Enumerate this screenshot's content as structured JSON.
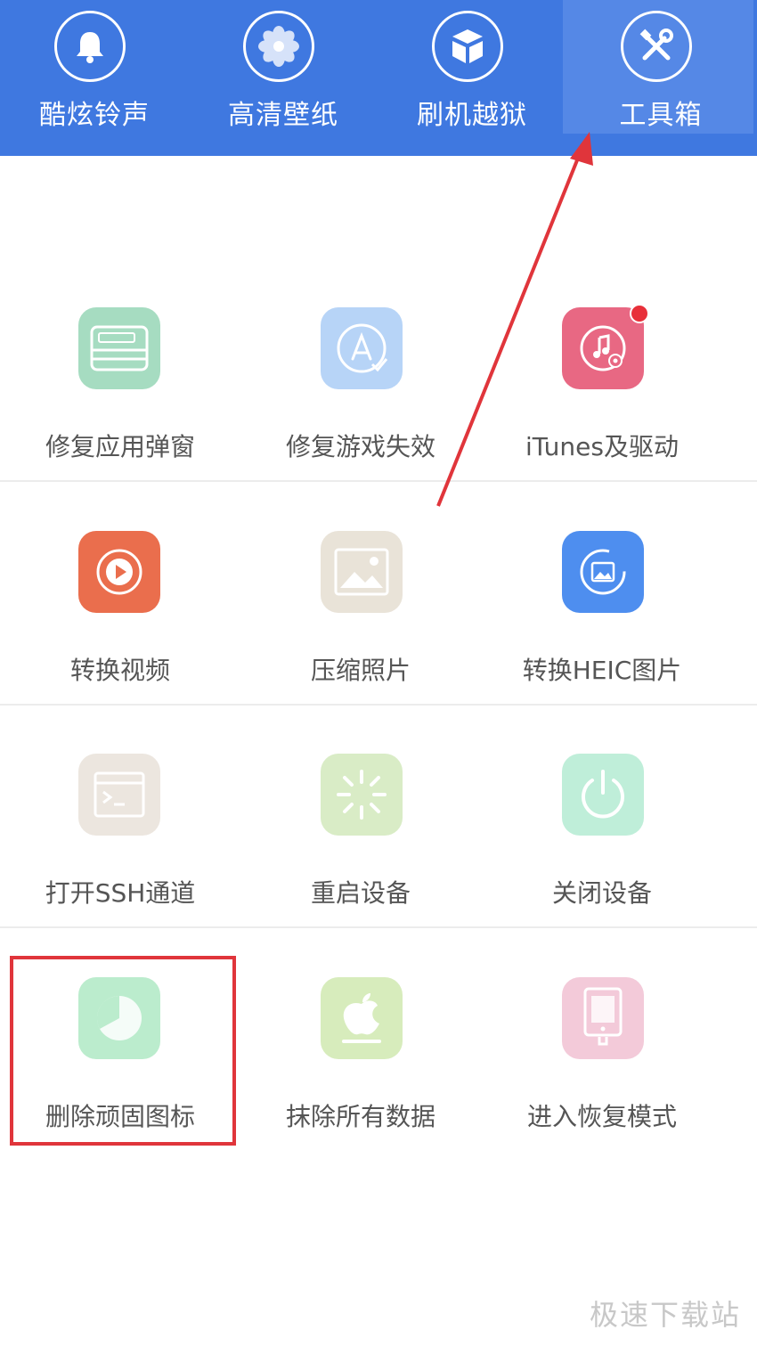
{
  "nav": {
    "items": [
      {
        "label": "酷炫铃声",
        "icon": "bell-icon"
      },
      {
        "label": "高清壁纸",
        "icon": "flower-icon"
      },
      {
        "label": "刷机越狱",
        "icon": "box-icon"
      },
      {
        "label": "工具箱",
        "icon": "tools-icon",
        "active": true
      }
    ]
  },
  "tools": {
    "rows": [
      [
        {
          "label": "修复应用弹窗",
          "icon": "apple-id-card-icon",
          "color": "#a6dcc1"
        },
        {
          "label": "修复游戏失效",
          "icon": "app-store-icon",
          "color": "#b7d4f7"
        },
        {
          "label": "iTunes及驱动",
          "icon": "music-gear-icon",
          "color": "#e86883",
          "badge": true
        }
      ],
      [
        {
          "label": "转换视频",
          "icon": "video-play-icon",
          "color": "#ea6e4d"
        },
        {
          "label": "压缩照片",
          "icon": "picture-icon",
          "color": "#e9e3d8"
        },
        {
          "label": "转换HEIC图片",
          "icon": "photo-convert-icon",
          "color": "#4e8eef"
        }
      ],
      [
        {
          "label": "打开SSH通道",
          "icon": "terminal-icon",
          "color": "#ece6df"
        },
        {
          "label": "重启设备",
          "icon": "loading-icon",
          "color": "#d9ecc6"
        },
        {
          "label": "关闭设备",
          "icon": "power-icon",
          "color": "#bfeed9"
        }
      ],
      [
        {
          "label": "删除顽固图标",
          "icon": "pie-clock-icon",
          "color": "#bbeccd"
        },
        {
          "label": "抹除所有数据",
          "icon": "apple-erase-icon",
          "color": "#d7ecbc"
        },
        {
          "label": "进入恢复模式",
          "icon": "ipad-icon",
          "color": "#f3cad9"
        }
      ]
    ]
  },
  "watermark": "极速下载站",
  "colors": {
    "topbar": "#3f78e0",
    "highlight_box": "#e0353b",
    "arrow": "#e0353b"
  }
}
